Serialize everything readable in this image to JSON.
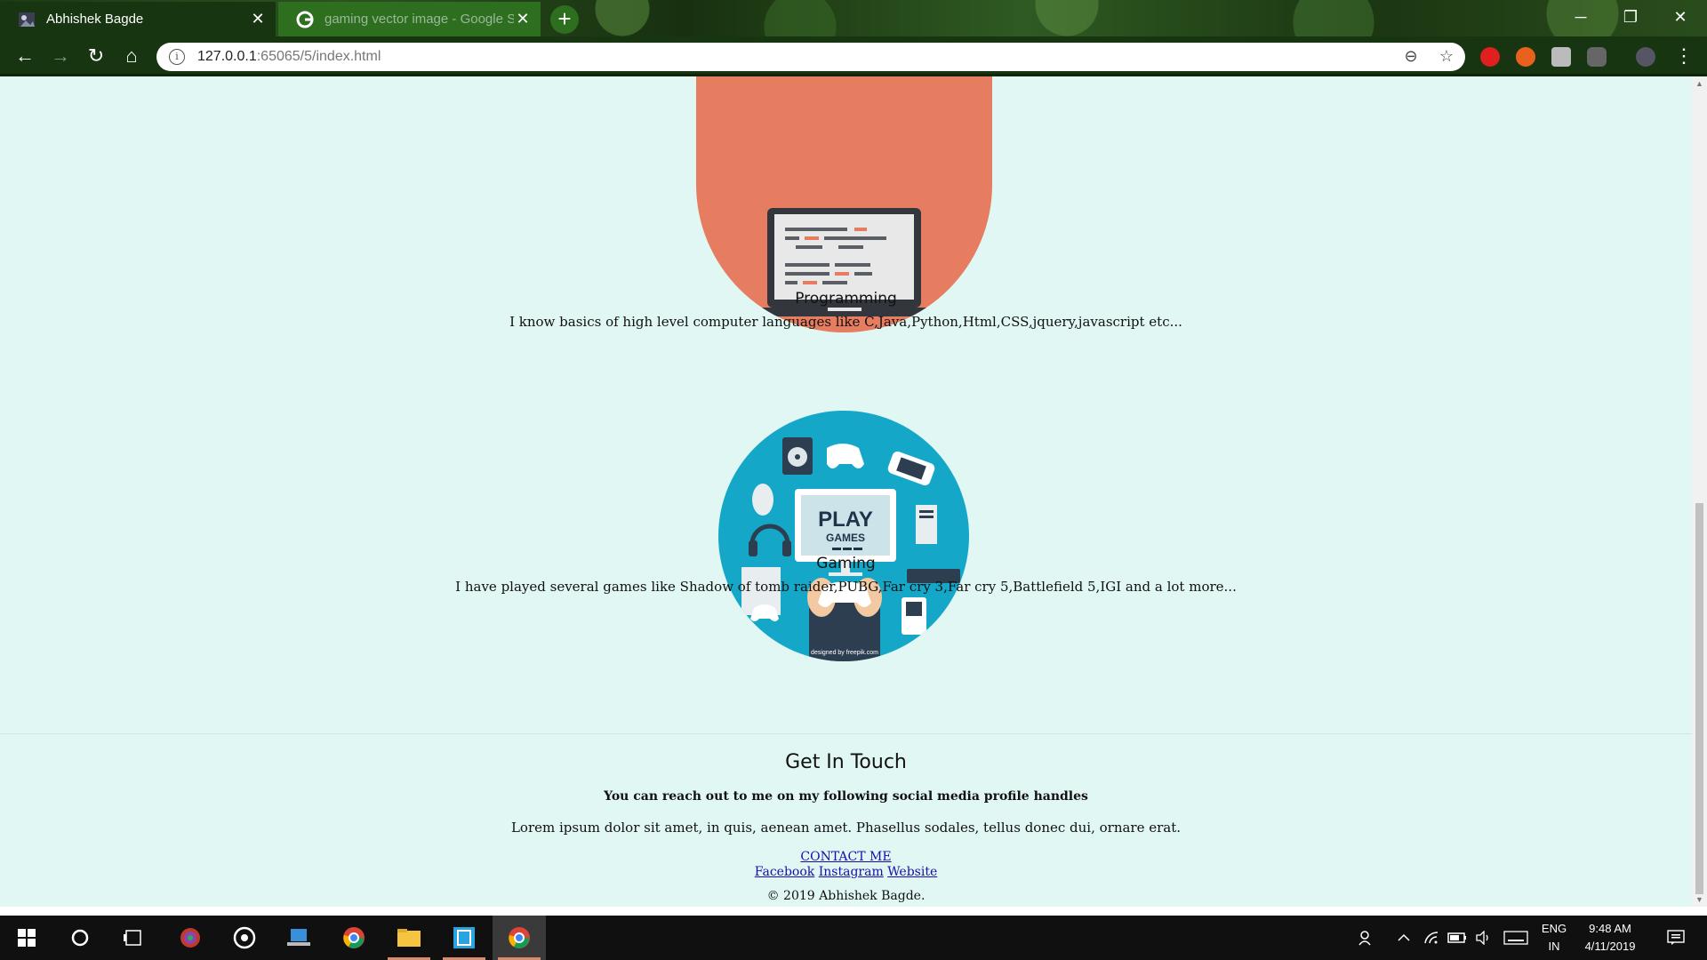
{
  "browser": {
    "tabs": [
      {
        "title": "Abhishek Bagde",
        "close": "✕"
      },
      {
        "title": "gaming vector image - Google S",
        "close": "✕"
      }
    ],
    "new_tab": "+",
    "window_controls": {
      "minimize": "─",
      "restore": "❐",
      "close": "✕"
    },
    "nav": {
      "back": "←",
      "forward": "→",
      "reload": "↻",
      "home": "⌂"
    },
    "address": {
      "host": "127.0.0.1",
      "rest": ":65065/5/index.html"
    },
    "omnibox_icons": {
      "zoom": "⊖",
      "bookmark": "☆",
      "menu": "⋮"
    }
  },
  "page": {
    "programming": {
      "title": "Programming",
      "text": "I know basics of high level computer languages like C,Java,Python,Html,CSS,jquery,javascript etc..."
    },
    "gaming": {
      "title": "Gaming",
      "text": "I have played several games like Shadow of tomb raider,PUBG,Far cry 3,Far cry 5,Battlefield 5,IGI and a lot more...",
      "image_text": {
        "play": "PLAY",
        "games": "GAMES",
        "credit": "designed by freepik.com"
      }
    },
    "contact": {
      "heading": "Get In Touch",
      "subheading": "You can reach out to me on my following social media profile handles",
      "lorem": "Lorem ipsum dolor sit amet, in quis, aenean amet. Phasellus sodales, tellus donec dui, ornare erat.",
      "contact_link": "CONTACT ME",
      "social_links": [
        "Facebook",
        "Instagram",
        "Website"
      ]
    },
    "copyright": "© 2019 Abhishek Bagde."
  },
  "taskbar": {
    "lang": "ENG",
    "region": "IN",
    "time": "9:48 AM",
    "date": "4/11/2019"
  },
  "colors": {
    "page_bg": "#e0f7f3",
    "programming_circle": "#e67c60",
    "gaming_circle": "#14a7c8",
    "browser_frame": "#163510"
  }
}
